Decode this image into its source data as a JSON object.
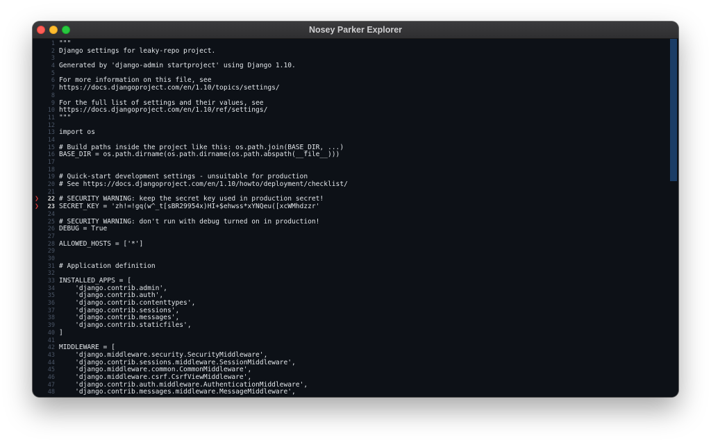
{
  "window": {
    "title": "Nosey Parker Explorer"
  },
  "editor": {
    "lines": [
      {
        "n": "1",
        "text": "\"\"\"",
        "flag": ""
      },
      {
        "n": "2",
        "text": "Django settings for leaky-repo project.",
        "flag": ""
      },
      {
        "n": "3",
        "text": "",
        "flag": ""
      },
      {
        "n": "4",
        "text": "Generated by 'django-admin startproject' using Django 1.10.",
        "flag": ""
      },
      {
        "n": "5",
        "text": "",
        "flag": ""
      },
      {
        "n": "6",
        "text": "For more information on this file, see",
        "flag": ""
      },
      {
        "n": "7",
        "text": "https://docs.djangoproject.com/en/1.10/topics/settings/",
        "flag": ""
      },
      {
        "n": "8",
        "text": "",
        "flag": ""
      },
      {
        "n": "9",
        "text": "For the full list of settings and their values, see",
        "flag": ""
      },
      {
        "n": "10",
        "text": "https://docs.djangoproject.com/en/1.10/ref/settings/",
        "flag": ""
      },
      {
        "n": "11",
        "text": "\"\"\"",
        "flag": ""
      },
      {
        "n": "12",
        "text": "",
        "flag": ""
      },
      {
        "n": "13",
        "text": "import os",
        "flag": ""
      },
      {
        "n": "14",
        "text": "",
        "flag": ""
      },
      {
        "n": "15",
        "text": "# Build paths inside the project like this: os.path.join(BASE_DIR, ...)",
        "flag": ""
      },
      {
        "n": "16",
        "text": "BASE_DIR = os.path.dirname(os.path.dirname(os.path.abspath(__file__)))",
        "flag": ""
      },
      {
        "n": "17",
        "text": "",
        "flag": ""
      },
      {
        "n": "18",
        "text": "",
        "flag": ""
      },
      {
        "n": "19",
        "text": "# Quick-start development settings - unsuitable for production",
        "flag": ""
      },
      {
        "n": "20",
        "text": "# See https://docs.djangoproject.com/en/1.10/howto/deployment/checklist/",
        "flag": ""
      },
      {
        "n": "21",
        "text": "",
        "flag": ""
      },
      {
        "n": "22",
        "text": "# SECURITY WARNING: keep the secret key used in production secret!",
        "flag": "❯"
      },
      {
        "n": "23",
        "text": "SECRET_KEY = 'zh!=!gq(w^_t[sBR29954x)HI+$ehwss*xYNQeu([xcWMhdzzr'",
        "flag": "❯"
      },
      {
        "n": "24",
        "text": "",
        "flag": ""
      },
      {
        "n": "25",
        "text": "# SECURITY WARNING: don't run with debug turned on in production!",
        "flag": ""
      },
      {
        "n": "26",
        "text": "DEBUG = True",
        "flag": ""
      },
      {
        "n": "27",
        "text": "",
        "flag": ""
      },
      {
        "n": "28",
        "text": "ALLOWED_HOSTS = ['*']",
        "flag": ""
      },
      {
        "n": "29",
        "text": "",
        "flag": ""
      },
      {
        "n": "30",
        "text": "",
        "flag": ""
      },
      {
        "n": "31",
        "text": "# Application definition",
        "flag": ""
      },
      {
        "n": "32",
        "text": "",
        "flag": ""
      },
      {
        "n": "33",
        "text": "INSTALLED_APPS = [",
        "flag": ""
      },
      {
        "n": "34",
        "text": "    'django.contrib.admin',",
        "flag": ""
      },
      {
        "n": "35",
        "text": "    'django.contrib.auth',",
        "flag": ""
      },
      {
        "n": "36",
        "text": "    'django.contrib.contenttypes',",
        "flag": ""
      },
      {
        "n": "37",
        "text": "    'django.contrib.sessions',",
        "flag": ""
      },
      {
        "n": "38",
        "text": "    'django.contrib.messages',",
        "flag": ""
      },
      {
        "n": "39",
        "text": "    'django.contrib.staticfiles',",
        "flag": ""
      },
      {
        "n": "40",
        "text": "]",
        "flag": ""
      },
      {
        "n": "41",
        "text": "",
        "flag": ""
      },
      {
        "n": "42",
        "text": "MIDDLEWARE = [",
        "flag": ""
      },
      {
        "n": "43",
        "text": "    'django.middleware.security.SecurityMiddleware',",
        "flag": ""
      },
      {
        "n": "44",
        "text": "    'django.contrib.sessions.middleware.SessionMiddleware',",
        "flag": ""
      },
      {
        "n": "45",
        "text": "    'django.middleware.common.CommonMiddleware',",
        "flag": ""
      },
      {
        "n": "46",
        "text": "    'django.middleware.csrf.CsrfViewMiddleware',",
        "flag": ""
      },
      {
        "n": "47",
        "text": "    'django.contrib.auth.middleware.AuthenticationMiddleware',",
        "flag": ""
      },
      {
        "n": "48",
        "text": "    'django.contrib.messages.middleware.MessageMiddleware',",
        "flag": ""
      }
    ]
  },
  "colors": {
    "editor_bg": "#0d1117",
    "match_marker": "#d03a3a",
    "scrollbar_thumb": "#1b3d66"
  }
}
